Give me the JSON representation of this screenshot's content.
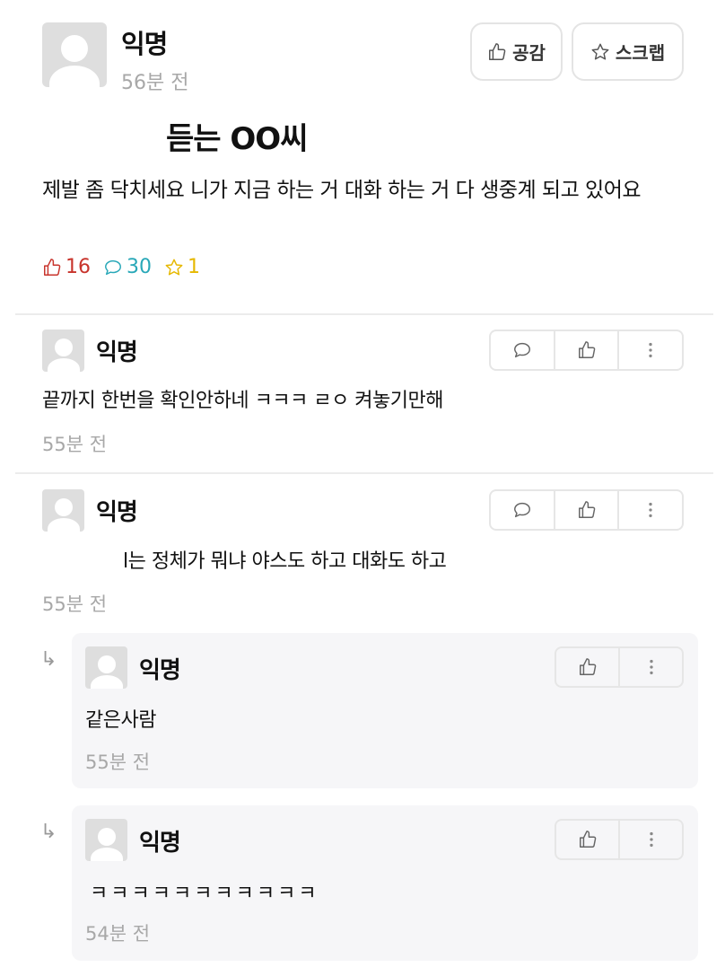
{
  "post": {
    "author": "익명",
    "time": "56분 전",
    "title": "듣는 OO씨",
    "body": "제발 좀 닥치세요 니가 지금 하는 거 대화 하는 거 다 생중계 되고 있어요",
    "like_button": "공감",
    "scrap_button": "스크랩",
    "stats": {
      "likes": "16",
      "comments": "30",
      "scraps": "1"
    },
    "colors": {
      "likes": "#c8342c",
      "comments": "#29a8b8",
      "scraps": "#e6b800"
    }
  },
  "comments": [
    {
      "author": "익명",
      "text": "끝까지 한번을 확인안하네 ㅋㅋㅋ ㄹㅇ 켜놓기만해",
      "time": "55분 전"
    },
    {
      "author": "익명",
      "text": "l는 정체가 뭐냐 야스도 하고 대화도 하고",
      "time": "55분 전"
    }
  ],
  "replies": [
    {
      "author": "익명",
      "text": "같은사람",
      "time": "55분 전",
      "arrow": "↳"
    },
    {
      "author": "익명",
      "text": "ㅋㅋㅋㅋㅋㅋㅋㅋㅋㅋㅋ",
      "time": "54분 전",
      "arrow": "↳"
    }
  ]
}
